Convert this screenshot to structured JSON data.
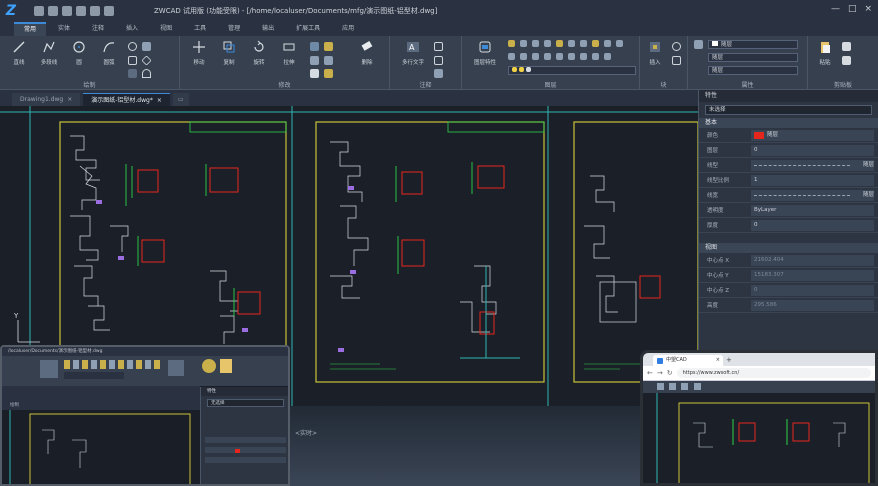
{
  "window": {
    "title": "ZWCAD  试用版 (功能受限) - [/home/localuser/Documents/mfg/演示图纸-铝型材.dwg]",
    "controls": [
      "—",
      "□",
      "×"
    ]
  },
  "ribbon_tabs": [
    "常用",
    "实体",
    "注释",
    "插入",
    "视图",
    "工具",
    "管理",
    "输出",
    "扩展工具",
    "应用"
  ],
  "ribbon": {
    "draw": {
      "label": "绘制",
      "buttons": [
        "直线",
        "多段线",
        "圆",
        "圆弧"
      ]
    },
    "modify": {
      "label": "修改",
      "buttons": [
        "移动",
        "复制",
        "旋转",
        "拉伸",
        "删除"
      ]
    },
    "annotate": {
      "label": "注释",
      "buttons": [
        "多行文字",
        "标注"
      ]
    },
    "layers": {
      "label": "图层",
      "buttons": [
        "图层特性"
      ]
    },
    "block": {
      "label": "块",
      "buttons": [
        "插入"
      ]
    },
    "properties": {
      "label": "属性",
      "combos": [
        "随层",
        "随层",
        "随层"
      ]
    },
    "clipboard": {
      "label": "剪贴板",
      "buttons": [
        "粘贴"
      ]
    }
  },
  "doc_tabs": [
    {
      "label": "Drawing1.dwg",
      "active": false
    },
    {
      "label": "演示图纸-铝型材.dwg*",
      "active": true
    }
  ],
  "properties_panel": {
    "title": "特性",
    "selection": "未选择",
    "basic_section": "基本",
    "basic": [
      {
        "key": "颜色",
        "value": "随层",
        "swatch": "#e5261c"
      },
      {
        "key": "图层",
        "value": "0"
      },
      {
        "key": "线型",
        "value": "随层",
        "line": true
      },
      {
        "key": "线型比例",
        "value": "1"
      },
      {
        "key": "线宽",
        "value": "随层",
        "line": true
      },
      {
        "key": "透明度",
        "value": "ByLayer"
      },
      {
        "key": "厚度",
        "value": "0"
      }
    ],
    "view_section": "视图",
    "view": [
      {
        "key": "中心点 X",
        "value": "21602.404"
      },
      {
        "key": "中心点 Y",
        "value": "15183.307"
      },
      {
        "key": "中心点 Z",
        "value": "0"
      },
      {
        "key": "高度",
        "value": "295.586"
      }
    ]
  },
  "command_line": "<实时>",
  "laptop": {
    "title": "/localuser/Documents/演示图纸-铝型材.dwg",
    "tabs_label": "绘制",
    "props_title": "特性",
    "props_sel": "无选择"
  },
  "browser": {
    "tab_label": "中望CAD",
    "url": "https://www.zwsoft.cn/"
  },
  "colors": {
    "accent": "#3c8ad8",
    "drawing_frame": "#c8c23a",
    "highlight_red": "#e5261c",
    "highlight_green": "#2ed24a"
  }
}
